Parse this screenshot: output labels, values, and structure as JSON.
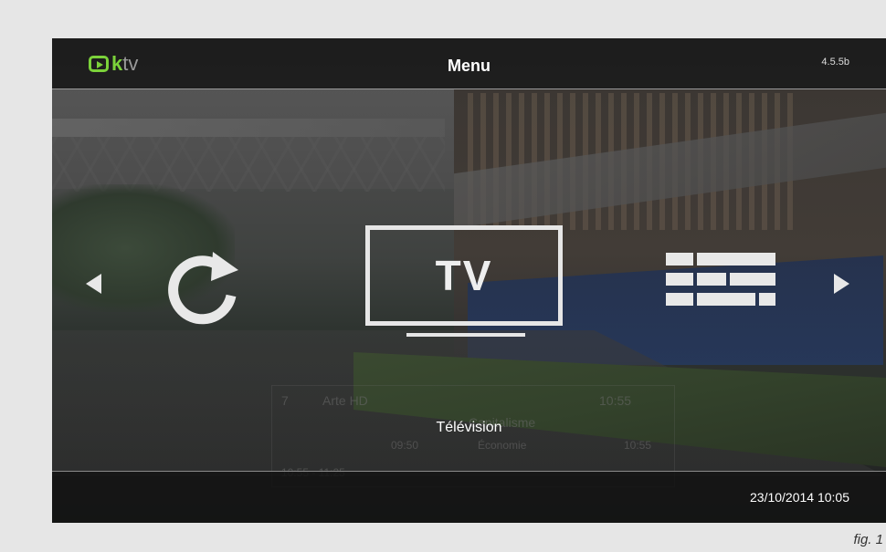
{
  "app": {
    "logo_k": "k",
    "logo_tv": "tv",
    "logo_icon": "play-icon",
    "brand_color": "#7bd23a",
    "title": "Menu",
    "version": "4.5.5b"
  },
  "menu": {
    "items": [
      {
        "name": "refresh",
        "icon": "refresh-icon"
      },
      {
        "name": "tv",
        "label": "TV"
      },
      {
        "name": "guide",
        "icon": "guide-icon"
      }
    ],
    "selected_caption": "Télévision",
    "nav_left_icon": "chevron-left-icon",
    "nav_right_icon": "chevron-right-icon"
  },
  "status": {
    "datetime": "23/10/2014 10:05"
  },
  "background_info": {
    "channel_number": "7",
    "channel_name": "Arte HD",
    "time_end": "09:50",
    "program_time": "10:55",
    "program_title": "Capitalisme",
    "program_category": "Économie",
    "program_end": "10:55",
    "next_slot": "10:55 - 11:25"
  },
  "figure_caption": "fig. 1"
}
